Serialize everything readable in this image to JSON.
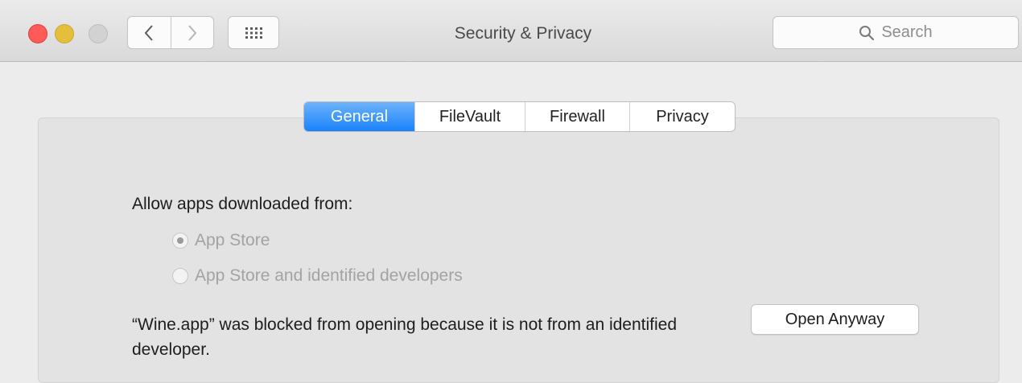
{
  "window": {
    "title": "Security & Privacy"
  },
  "toolbar": {
    "back_icon": "chevron-left-icon",
    "forward_icon": "chevron-right-icon",
    "grid_icon": "grid-icon",
    "search_placeholder": "Search"
  },
  "tabs": [
    {
      "label": "General",
      "active": true
    },
    {
      "label": "FileVault",
      "active": false
    },
    {
      "label": "Firewall",
      "active": false
    },
    {
      "label": "Privacy",
      "active": false
    }
  ],
  "general": {
    "allow_label": "Allow apps downloaded from:",
    "options": [
      {
        "label": "App Store",
        "selected": true
      },
      {
        "label": "App Store and identified developers",
        "selected": false
      }
    ],
    "blocked_message": "“Wine.app” was blocked from opening because it is not from an identified developer.",
    "open_anyway_label": "Open Anyway"
  },
  "colors": {
    "accent": "#1a82fb",
    "close": "#fc5b57",
    "minimize": "#e5bf3c"
  }
}
